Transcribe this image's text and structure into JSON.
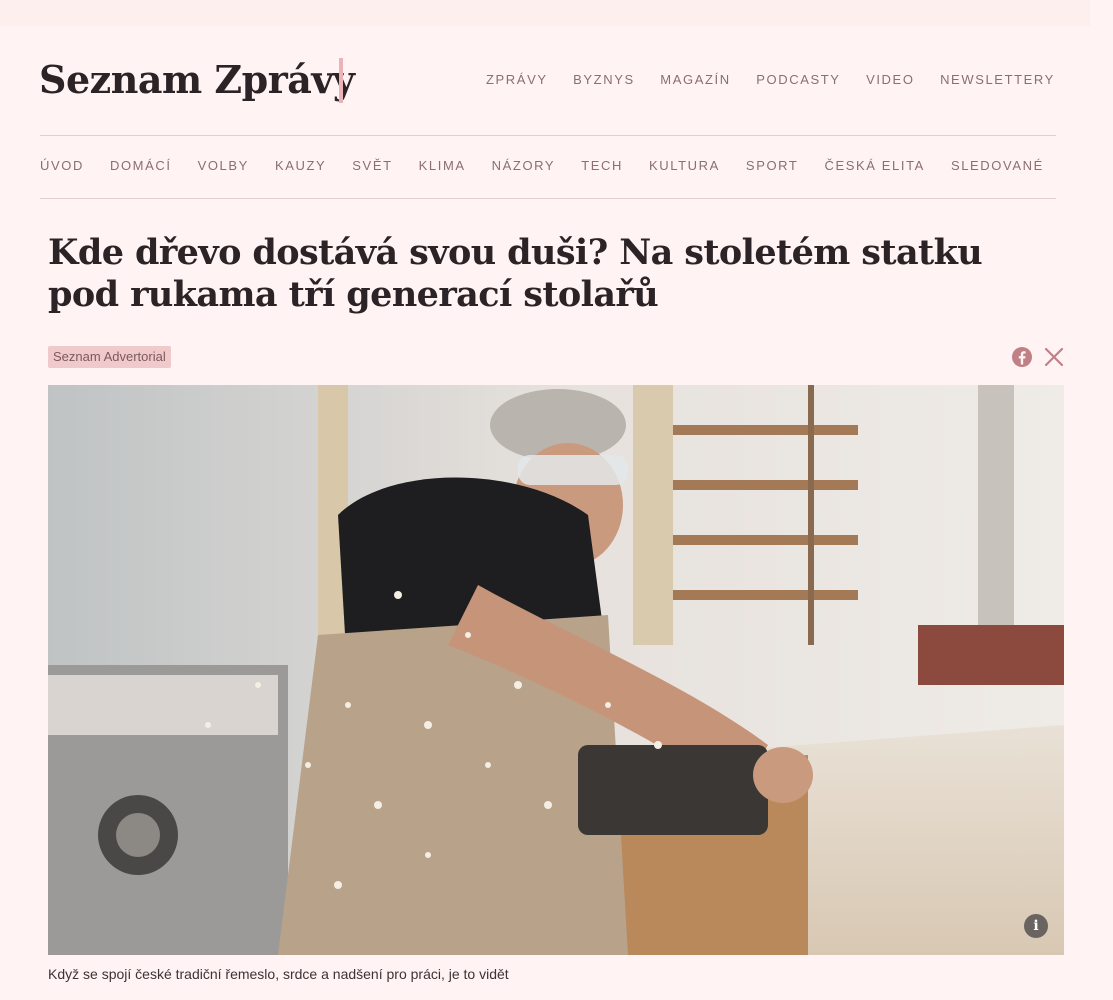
{
  "site": {
    "logo": "Seznam Zprávy"
  },
  "top_nav": [
    "ZPRÁVY",
    "BYZNYS",
    "MAGAZÍN",
    "PODCASTY",
    "VIDEO",
    "NEWSLETTERY"
  ],
  "section_nav": [
    "ÚVOD",
    "DOMÁCÍ",
    "VOLBY",
    "KAUZY",
    "SVĚT",
    "KLIMA",
    "NÁZORY",
    "TECH",
    "KULTURA",
    "SPORT",
    "ČESKÁ ELITA",
    "SLEDOVANÉ"
  ],
  "article": {
    "title": "Kde dřevo dostává svou duši? Na stoletém statku pod rukama tří generací stolařů",
    "badge": "Seznam Advertorial",
    "caption": "Když se spojí české tradiční řemeslo, srdce a nadšení pro práci, je to vidět",
    "info_label": "i"
  },
  "share": {
    "icons": [
      "facebook-icon",
      "x-icon"
    ]
  },
  "colors": {
    "background": "#fff4f3",
    "accent_bar": "#e9b3b9",
    "nav_text": "#8a6e72",
    "badge_bg": "#f0c9cb",
    "share_icon": "#c17f86"
  }
}
